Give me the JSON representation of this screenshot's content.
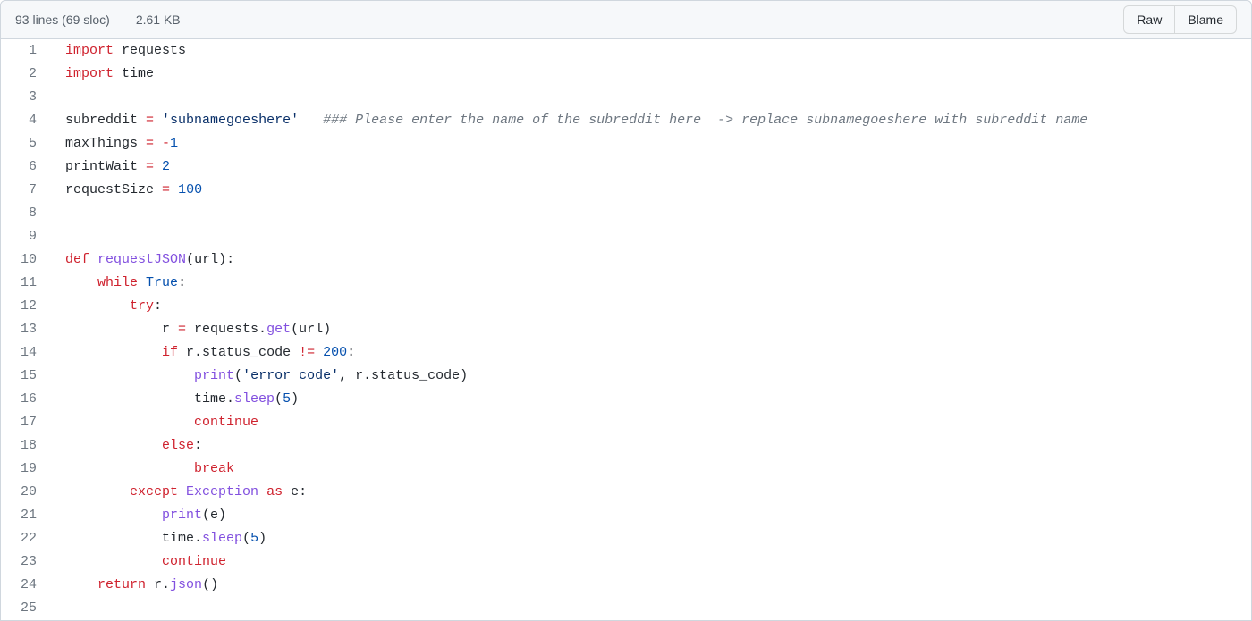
{
  "header": {
    "lines_label": "93 lines (69 sloc)",
    "size_label": "2.61 KB",
    "raw_label": "Raw",
    "blame_label": "Blame"
  },
  "code": {
    "start_line": 1,
    "lines": [
      [
        [
          "kw",
          "import"
        ],
        [
          "txt",
          " requests"
        ]
      ],
      [
        [
          "kw",
          "import"
        ],
        [
          "txt",
          " time"
        ]
      ],
      [],
      [
        [
          "txt",
          "subreddit "
        ],
        [
          "op",
          "="
        ],
        [
          "txt",
          " "
        ],
        [
          "str",
          "'subnamegoeshere'"
        ],
        [
          "txt",
          "   "
        ],
        [
          "cm",
          "### Please enter the name of the subreddit here  -> replace subnamegoeshere with subreddit name"
        ]
      ],
      [
        [
          "txt",
          "maxThings "
        ],
        [
          "op",
          "="
        ],
        [
          "txt",
          " "
        ],
        [
          "op",
          "-"
        ],
        [
          "num",
          "1"
        ]
      ],
      [
        [
          "txt",
          "printWait "
        ],
        [
          "op",
          "="
        ],
        [
          "txt",
          " "
        ],
        [
          "num",
          "2"
        ]
      ],
      [
        [
          "txt",
          "requestSize "
        ],
        [
          "op",
          "="
        ],
        [
          "txt",
          " "
        ],
        [
          "num",
          "100"
        ]
      ],
      [],
      [],
      [
        [
          "kw",
          "def"
        ],
        [
          "txt",
          " "
        ],
        [
          "fn",
          "requestJSON"
        ],
        [
          "txt",
          "(url):"
        ]
      ],
      [
        [
          "txt",
          "    "
        ],
        [
          "kw",
          "while"
        ],
        [
          "txt",
          " "
        ],
        [
          "bool",
          "True"
        ],
        [
          "txt",
          ":"
        ]
      ],
      [
        [
          "txt",
          "        "
        ],
        [
          "kw",
          "try"
        ],
        [
          "txt",
          ":"
        ]
      ],
      [
        [
          "txt",
          "            r "
        ],
        [
          "op",
          "="
        ],
        [
          "txt",
          " requests."
        ],
        [
          "fn",
          "get"
        ],
        [
          "txt",
          "(url)"
        ]
      ],
      [
        [
          "txt",
          "            "
        ],
        [
          "kw",
          "if"
        ],
        [
          "txt",
          " r.status_code "
        ],
        [
          "op",
          "!="
        ],
        [
          "txt",
          " "
        ],
        [
          "num",
          "200"
        ],
        [
          "txt",
          ":"
        ]
      ],
      [
        [
          "txt",
          "                "
        ],
        [
          "fn",
          "print"
        ],
        [
          "txt",
          "("
        ],
        [
          "str",
          "'error code'"
        ],
        [
          "txt",
          ", r.status_code)"
        ]
      ],
      [
        [
          "txt",
          "                time."
        ],
        [
          "fn",
          "sleep"
        ],
        [
          "txt",
          "("
        ],
        [
          "num",
          "5"
        ],
        [
          "txt",
          ")"
        ]
      ],
      [
        [
          "txt",
          "                "
        ],
        [
          "kw",
          "continue"
        ]
      ],
      [
        [
          "txt",
          "            "
        ],
        [
          "kw",
          "else"
        ],
        [
          "txt",
          ":"
        ]
      ],
      [
        [
          "txt",
          "                "
        ],
        [
          "kw",
          "break"
        ]
      ],
      [
        [
          "txt",
          "        "
        ],
        [
          "kw",
          "except"
        ],
        [
          "txt",
          " "
        ],
        [
          "fn",
          "Exception"
        ],
        [
          "txt",
          " "
        ],
        [
          "kw",
          "as"
        ],
        [
          "txt",
          " e:"
        ]
      ],
      [
        [
          "txt",
          "            "
        ],
        [
          "fn",
          "print"
        ],
        [
          "txt",
          "(e)"
        ]
      ],
      [
        [
          "txt",
          "            time."
        ],
        [
          "fn",
          "sleep"
        ],
        [
          "txt",
          "("
        ],
        [
          "num",
          "5"
        ],
        [
          "txt",
          ")"
        ]
      ],
      [
        [
          "txt",
          "            "
        ],
        [
          "kw",
          "continue"
        ]
      ],
      [
        [
          "txt",
          "    "
        ],
        [
          "kw",
          "return"
        ],
        [
          "txt",
          " r."
        ],
        [
          "fn",
          "json"
        ],
        [
          "txt",
          "()"
        ]
      ],
      []
    ]
  }
}
